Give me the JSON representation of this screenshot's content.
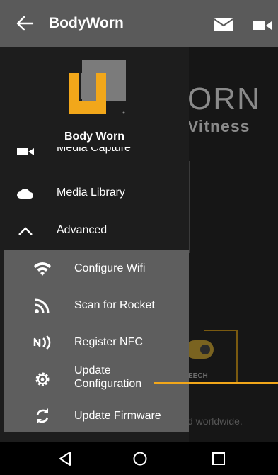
{
  "appbar": {
    "title": "BodyWorn"
  },
  "background": {
    "brand_line1": "ORN",
    "brand_line2": "Vitness",
    "device_label": "EECH",
    "footer_text": "d worldwide."
  },
  "drawer": {
    "logo_name": "Body Worn",
    "items": [
      {
        "label": "Media Capture",
        "icon": "video-icon"
      },
      {
        "label": "Media Library",
        "icon": "cloud-icon"
      },
      {
        "label": "Advanced",
        "icon": "chevron-up-icon"
      }
    ],
    "submenu": [
      {
        "label": "Configure Wifi",
        "icon": "wifi-icon"
      },
      {
        "label": "Scan for Rocket",
        "icon": "rss-icon"
      },
      {
        "label": "Register NFC",
        "icon": "nfc-icon"
      },
      {
        "label": "Update Configuration",
        "icon": "gear-icon"
      },
      {
        "label": "Update Firmware",
        "icon": "refresh-icon"
      }
    ]
  },
  "colors": {
    "accent": "#f2a71a",
    "appbar": "#5a5a5a",
    "drawer": "#1d1d1d",
    "submenu": "#5e5e5e"
  }
}
